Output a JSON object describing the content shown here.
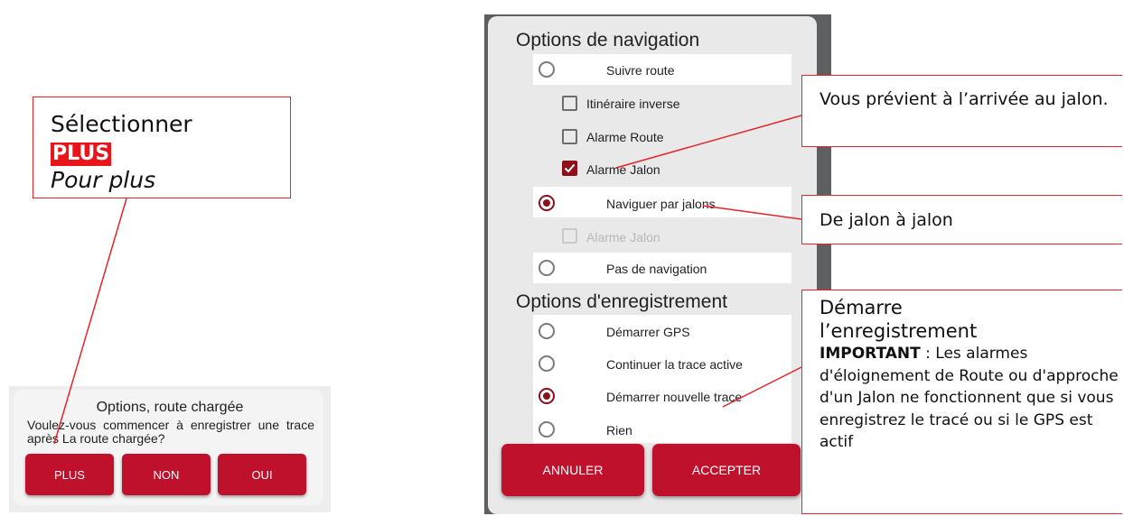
{
  "left_callout": {
    "line1": "Sélectionner",
    "highlight": "PLUS",
    "line3": "Pour plus"
  },
  "small_dialog": {
    "title": "Options, route chargée",
    "message": "Voulez-vous commencer à enregistrer une trace après La route chargée?",
    "buttons": [
      "PLUS",
      "NON",
      "OUI"
    ]
  },
  "nav_dialog": {
    "nav_title": "Options de navigation",
    "nav_items": [
      {
        "label": "Suivre route",
        "type": "radio",
        "checked": false
      },
      {
        "label": "Itinéraire inverse",
        "type": "checkbox",
        "checked": false
      },
      {
        "label": "Alarme Route",
        "type": "checkbox",
        "checked": false
      },
      {
        "label": "Alarme Jalon",
        "type": "checkbox",
        "checked": true
      },
      {
        "label": "Naviguer par jalons",
        "type": "radio",
        "checked": true
      },
      {
        "label": "Alarme Jalon",
        "type": "checkbox",
        "checked": false,
        "disabled": true
      },
      {
        "label": "Pas de navigation",
        "type": "radio",
        "checked": false
      }
    ],
    "rec_title": "Options d'enregistrement",
    "rec_items": [
      {
        "label": "Démarrer GPS",
        "checked": false
      },
      {
        "label": "Continuer la trace active",
        "checked": false
      },
      {
        "label": "Démarrer nouvelle trace",
        "checked": true
      },
      {
        "label": "Rien",
        "checked": false
      }
    ],
    "cancel_label": "ANNULER",
    "accept_label": "ACCEPTER"
  },
  "right_callouts": {
    "c1": "Vous prévient à l’arrivée au jalon.",
    "c2": "De jalon à jalon",
    "c3_line1": "Démarre",
    "c3_line2": "l’enregistrement",
    "c3_important": "IMPORTANT",
    "c3_body": " : Les alarmes d'éloignement de Route ou d'approche d'un Jalon ne fonctionnent que si vous enregistrez le tracé ou si le GPS est actif"
  },
  "colors": {
    "accent_red": "#c0112c",
    "dark_red": "#8d0f1b",
    "callout_border": "#e3262b"
  }
}
